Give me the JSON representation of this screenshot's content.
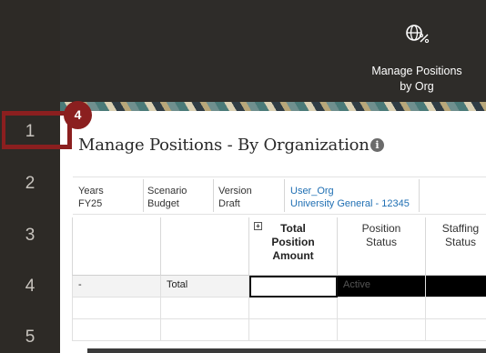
{
  "row_numbers": [
    "1",
    "2",
    "3",
    "4",
    "5"
  ],
  "tile": {
    "label_line1": "Manage Positions",
    "label_line2": "by Org",
    "icon": "globe-percent-icon"
  },
  "page": {
    "title": "Manage Positions - By Organization",
    "info_icon": "info-icon"
  },
  "pov": {
    "years_label": "Years",
    "years_value": "FY25",
    "scenario_label": "Scenario",
    "scenario_value": "Budget",
    "version_label": "Version",
    "version_value": "Draft",
    "entity_label": "User_Org",
    "entity_value": "University General - 12345"
  },
  "grid": {
    "headers": {
      "total_position_amount": [
        "Total",
        "Position",
        "Amount"
      ],
      "position_status": [
        "Position",
        "Status"
      ],
      "staffing_status": [
        "Staffing",
        "Status"
      ]
    },
    "rows": [
      {
        "col1": "-",
        "col2": "Total",
        "position_status": "Active"
      },
      {
        "col1": "",
        "col2": "",
        "position_status": ""
      },
      {
        "col1": "",
        "col2": "",
        "position_status": ""
      }
    ]
  },
  "callout": {
    "badge": "4"
  },
  "colors": {
    "callout": "#8b1f1f",
    "header_bg": "#2e2c29",
    "link": "#1f6fb3"
  }
}
